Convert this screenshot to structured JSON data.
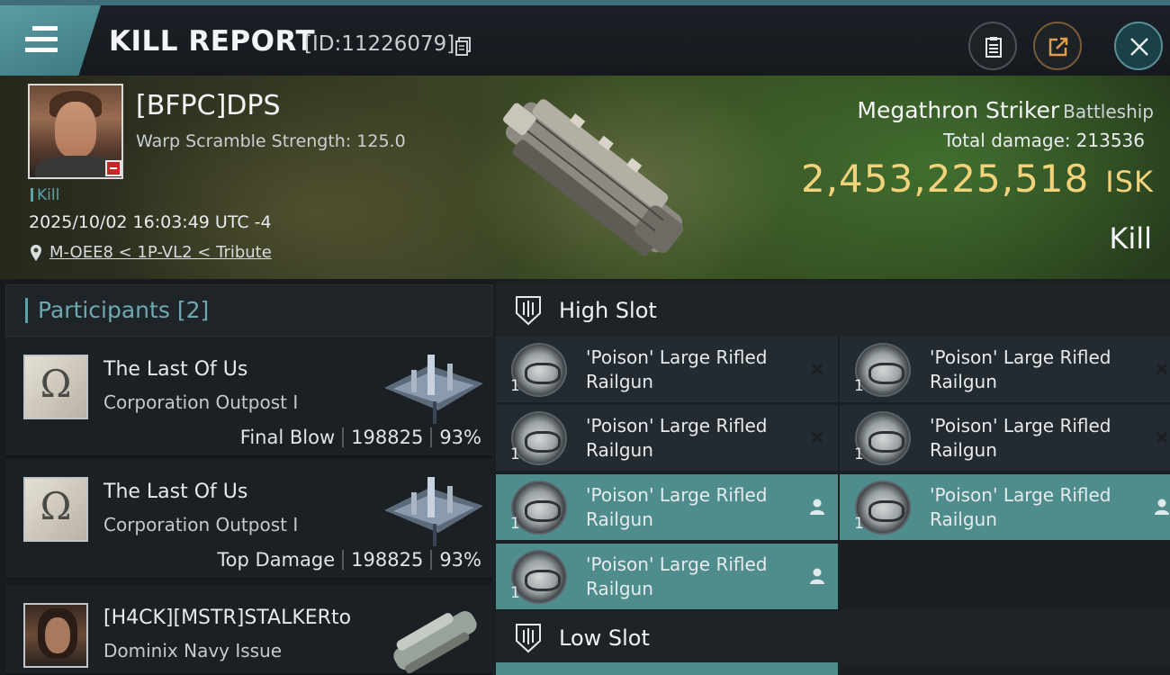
{
  "titlebar": {
    "title": "KILL REPORT",
    "id_text": "[ID:11226079]",
    "icons": [
      "menu-icon",
      "copy-icon",
      "clipboard-icon",
      "share-icon",
      "close-icon"
    ]
  },
  "victim": {
    "name": "[BFPC]DPS",
    "warp_scramble": "Warp Scramble Strength: 125.0",
    "kill_tag": "Kill",
    "datetime": "2025/10/02 16:03:49 UTC -4",
    "location": "M-OEE8 < 1P-VL2 < Tribute",
    "ship_name": "Megathron Striker",
    "ship_class": "Battleship",
    "total_damage_label": "Total damage:",
    "total_damage_value": "213536",
    "isk_value": "2,453,225,518",
    "isk_unit": "ISK",
    "result": "Kill"
  },
  "participants": {
    "header": "Participants",
    "count": "[2]",
    "items": [
      {
        "name": "The Last Of Us",
        "ship": "Corporation Outpost I",
        "role": "Final Blow",
        "damage": "198825",
        "percent": "93%",
        "logo": "omega-icon"
      },
      {
        "name": "The Last Of Us",
        "ship": "Corporation Outpost I",
        "role": "Top Damage",
        "damage": "198825",
        "percent": "93%",
        "logo": "omega-icon"
      },
      {
        "name": "[H4CK][MSTR]STALKERto",
        "ship": "Dominix Navy Issue",
        "role": "",
        "damage": "",
        "percent": "",
        "logo": "pilot-portrait"
      }
    ]
  },
  "slots": {
    "high_slot_label": "High Slot",
    "low_slot_label": "Low Slot",
    "modules": [
      {
        "name": "'Poison' Large Rifled Railgun",
        "qty": "1",
        "state": "destroyed"
      },
      {
        "name": "'Poison' Large Rifled Railgun",
        "qty": "1",
        "state": "destroyed"
      },
      {
        "name": "'Poison' Large Rifled Railgun",
        "qty": "1",
        "state": "destroyed"
      },
      {
        "name": "'Poison' Large Rifled Railgun",
        "qty": "1",
        "state": "destroyed"
      },
      {
        "name": "'Poison' Large Rifled Railgun",
        "qty": "1",
        "state": "dropped"
      },
      {
        "name": "'Poison' Large Rifled Railgun",
        "qty": "1",
        "state": "dropped"
      },
      {
        "name": "'Poison' Large Rifled Railgun",
        "qty": "1",
        "state": "dropped"
      }
    ],
    "destroyed_mark": "×"
  },
  "colors": {
    "accent": "#5aa3ab",
    "isk": "#f2d37c",
    "dropped_bg": "#4f8c8c"
  }
}
